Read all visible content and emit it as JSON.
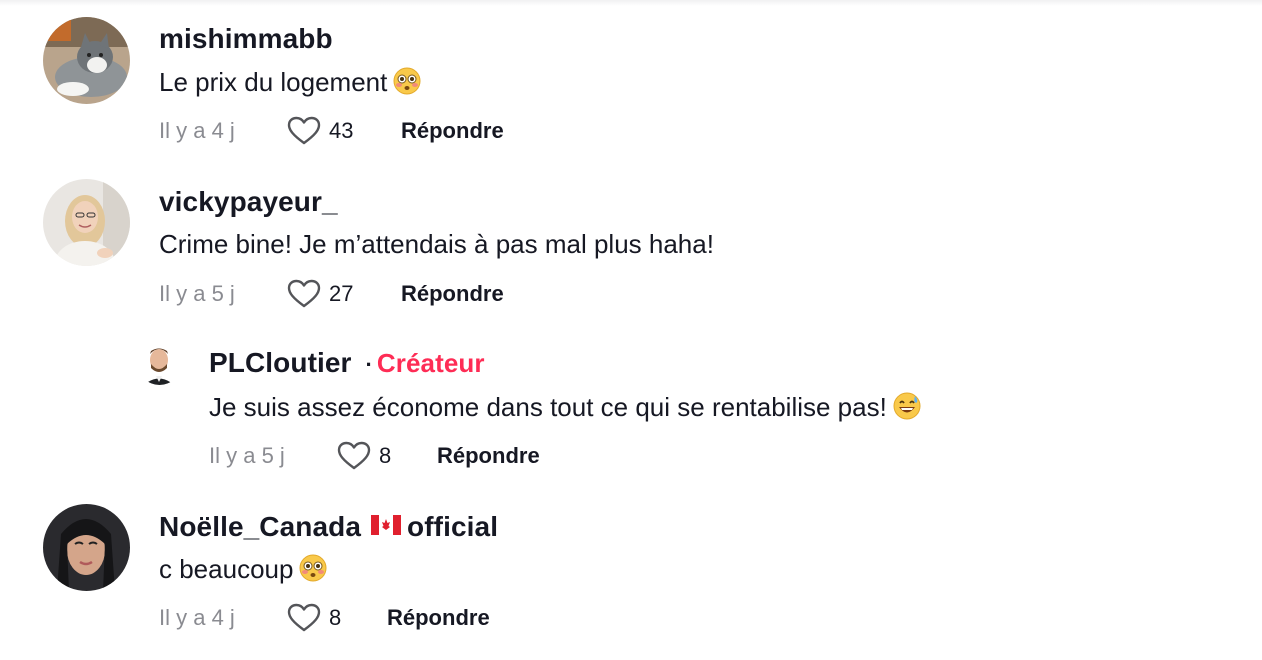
{
  "comments": [
    {
      "username": "mishimmabb",
      "text": "Le prix du logement",
      "time": "Il y a 4 j",
      "likes": "43",
      "reply": "Répondre",
      "emoji": "flushed-face-emoji"
    },
    {
      "username": "vickypayeur_",
      "text": "Crime bine! Je m’attendais à pas mal plus haha!",
      "time": "Il y a 5 j",
      "likes": "27",
      "reply": "Répondre"
    },
    {
      "username": "PLCloutier",
      "badge_sep": "·",
      "badge": "Créateur",
      "text": "Je suis assez économe dans tout ce qui se rentabilise pas!",
      "time": "Il y a 5 j",
      "likes": "8",
      "reply": "Répondre",
      "emoji": "grinning-sweat-emoji",
      "is_reply": true
    },
    {
      "username_part1": "Noëlle_Canada",
      "username_part2": "official",
      "flag": "canada-flag-emoji",
      "text": "c beaucoup",
      "time": "Il y a 4 j",
      "likes": "8",
      "reply": "Répondre",
      "emoji": "flushed-face-emoji"
    }
  ],
  "colors": {
    "primary_text": "#161823",
    "secondary_text": "#8a8b91",
    "creator_accent": "#fe2c55"
  }
}
